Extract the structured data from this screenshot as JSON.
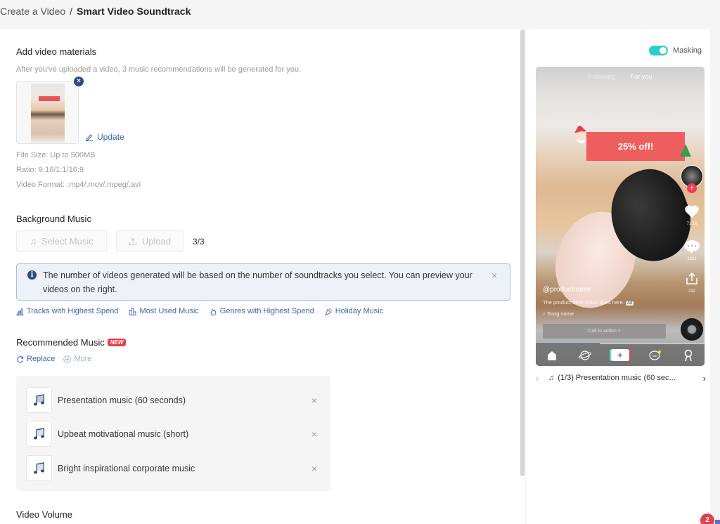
{
  "breadcrumb": {
    "parent": "Create a Video",
    "separator": "/",
    "current": "Smart Video Soundtrack"
  },
  "video_materials": {
    "title": "Add video materials",
    "hint": "After you've uploaded a video, 3 music recommendations will be generated for you.",
    "remove_icon": "×",
    "update_label": "Update",
    "specs": [
      "File Size: Up to 500MB",
      "Ratio: 9:16/1:1/16:9",
      "Video Format: .mp4/.mov/.mpeg/.avi"
    ]
  },
  "background_music": {
    "title": "Background Music",
    "select_music_label": "Select Music",
    "upload_label": "Upload",
    "counter": "3/3",
    "alert_text": "The number of videos generated will be based on the number of soundtracks you select. You can preview your videos on the right.",
    "alert_info_icon": "i",
    "alert_close": "×",
    "filters": [
      {
        "label": "Tracks with Highest Spend",
        "icon": "chart-icon"
      },
      {
        "label": "Most Used Music",
        "icon": "bar-chart-icon"
      },
      {
        "label": "Genres with Highest Spend",
        "icon": "flame-icon"
      },
      {
        "label": "Holiday Music",
        "icon": "party-icon"
      }
    ]
  },
  "recommended": {
    "title": "Recommended Music",
    "badge": "NEW",
    "replace_label": "Replace",
    "more_label": "More",
    "items": [
      {
        "title": "Presentation music (60 seconds)"
      },
      {
        "title": "Upbeat motivational music (short)"
      },
      {
        "title": "Bright inspirational corporate music"
      }
    ],
    "remove_icon": "×"
  },
  "video_volume": {
    "title": "Video Volume"
  },
  "preview": {
    "masking_label": "Masking",
    "masking_on": true,
    "tabs": [
      "Following",
      "For you"
    ],
    "promo_text": "25% off!",
    "follow_plus": "+",
    "likes": "71.1k",
    "comments": "1231",
    "shares": "232",
    "username": "@productname",
    "description": "The product description goes here.",
    "ad_tag": "Ad",
    "song_name": "Song name",
    "cta_label": "Call to action  >",
    "progress": 0.38,
    "nav_plus": "+",
    "prev_icon": "‹",
    "next_icon": "›",
    "current_track": "(1/3) Presentation music (60 sec..."
  },
  "notification": {
    "count": "2"
  },
  "colors": {
    "accent": "#3966b0",
    "toggle": "#2ccfc7",
    "badge": "#e2434b",
    "alert_bg": "#edf2f9",
    "alert_border": "#a9bfe0"
  }
}
